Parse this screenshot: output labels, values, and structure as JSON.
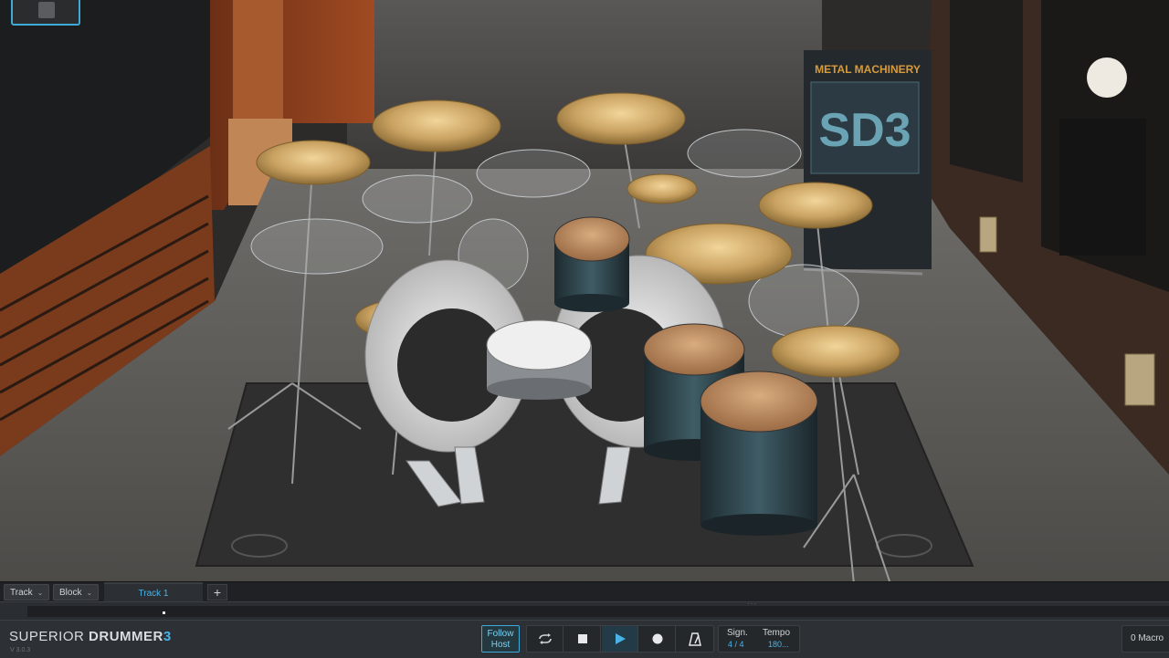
{
  "scene": {
    "banner_title": "METAL MACHINERY",
    "banner_logo": "SD3"
  },
  "trackbar": {
    "track_menu": "Track",
    "block_menu": "Block",
    "track_tab": "Track 1",
    "add_label": "+"
  },
  "transport": {
    "brand_part1": "SUPERIOR",
    "brand_part2": "DRUMMER",
    "brand_part3": "3",
    "version": "V 3.0.3",
    "follow_host_line1": "Follow",
    "follow_host_line2": "Host",
    "loop_icon": "loop-icon",
    "stop_icon": "stop-icon",
    "play_icon": "play-icon",
    "record_icon": "record-icon",
    "metronome_icon": "metronome-icon",
    "sign_label": "Sign.",
    "sign_value": "4 / 4",
    "tempo_label": "Tempo",
    "tempo_value": "180...",
    "macro_label": "0  Macro"
  },
  "colors": {
    "accent": "#4ab3e6",
    "panel": "#2d3034",
    "bronze": "#c9a261"
  }
}
